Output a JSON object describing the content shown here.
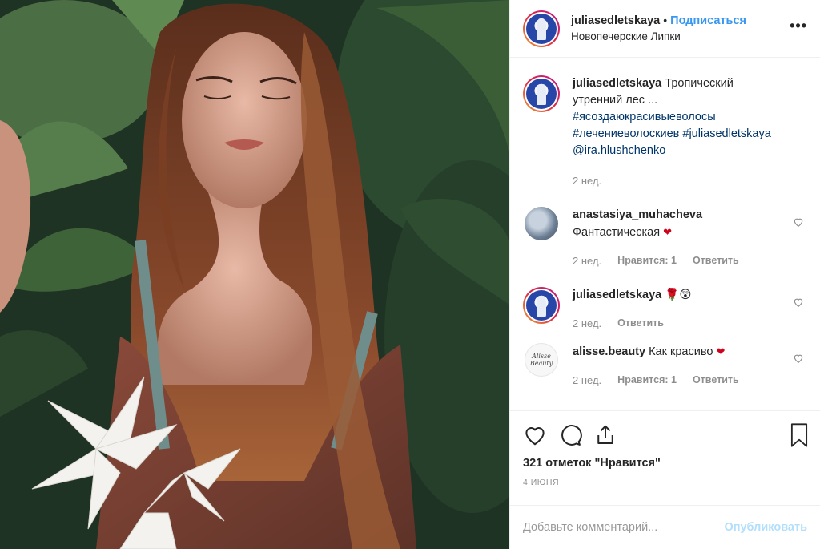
{
  "post": {
    "username": "juliasedletskaya",
    "separator": "•",
    "follow_label": "Подписаться",
    "location": "Новопечерские Липки",
    "more_label": "•••"
  },
  "caption": {
    "username": "juliasedletskaya",
    "text": "Тропический утренний лес ...",
    "tags": [
      "#ясоздаюкрасивыеволосы",
      "#лечениеволоскиев",
      "#juliasedletskaya"
    ],
    "mention": "@ira.hlushchenko",
    "time": "2 нед."
  },
  "comments": [
    {
      "username": "anastasiya_muhacheva",
      "text": "Фантастическая",
      "emoji": "❤",
      "time": "2 нед.",
      "likes": "Нравится: 1",
      "reply": "Ответить"
    },
    {
      "username": "juliasedletskaya",
      "text": "",
      "emoji": "🌹😲",
      "time": "2 нед.",
      "reply": "Ответить"
    },
    {
      "username": "alisse.beauty",
      "text": "Как красиво",
      "emoji": "❤",
      "time": "2 нед.",
      "likes": "Нравится: 1",
      "reply": "Ответить",
      "avatar_text": "Alisse Beauty"
    }
  ],
  "likes_text": "321 отметок \"Нравится\"",
  "date": "4 июня",
  "add_comment": {
    "placeholder": "Добавьте комментарий...",
    "publish_label": "Опубликовать"
  },
  "colors": {
    "link": "#3897f0",
    "tag": "#003569",
    "muted": "#8e8e8e",
    "publish_disabled": "#b2dffc",
    "heart_red": "#d0021b"
  },
  "icons": [
    "heart-icon",
    "comment-icon",
    "share-icon",
    "bookmark-icon",
    "more-icon"
  ]
}
